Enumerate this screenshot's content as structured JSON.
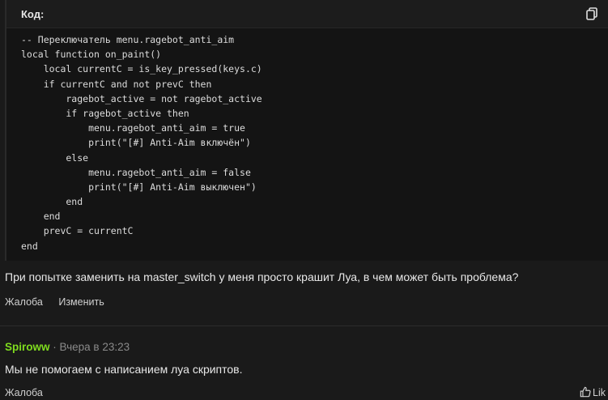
{
  "code_block": {
    "title": "Код:",
    "copy_icon": "copy-icon",
    "lines": [
      "-- Переключатель menu.ragebot_anti_aim",
      "local function on_paint()",
      "    local currentC = is_key_pressed(keys.c)",
      "    if currentC and not prevC then",
      "        ragebot_active = not ragebot_active",
      "        if ragebot_active then",
      "            menu.ragebot_anti_aim = true",
      "            print(\"[#] Anti-Aim включён\")",
      "        else",
      "            menu.ragebot_anti_aim = false",
      "            print(\"[#] Anti-Aim выключен\")",
      "        end",
      "    end",
      "    prevC = currentC",
      "end"
    ]
  },
  "post": {
    "text": "При попытке заменить на master_switch у меня просто крашит Луа, в чем может быть проблема?",
    "report_label": "Жалоба",
    "edit_label": "Изменить"
  },
  "reply": {
    "username": "Spiroww",
    "separator": "·",
    "timestamp": "Вчера в 23:23",
    "text": "Мы не помогаем с написанием луа скриптов.",
    "report_label": "Жалоба",
    "like_label": "Lik",
    "like_icon": "thumbs-up-icon"
  },
  "colors": {
    "background": "#1a1a1a",
    "code_background": "#141414",
    "username": "#7fdc1e",
    "muted": "#8a8a8a"
  }
}
